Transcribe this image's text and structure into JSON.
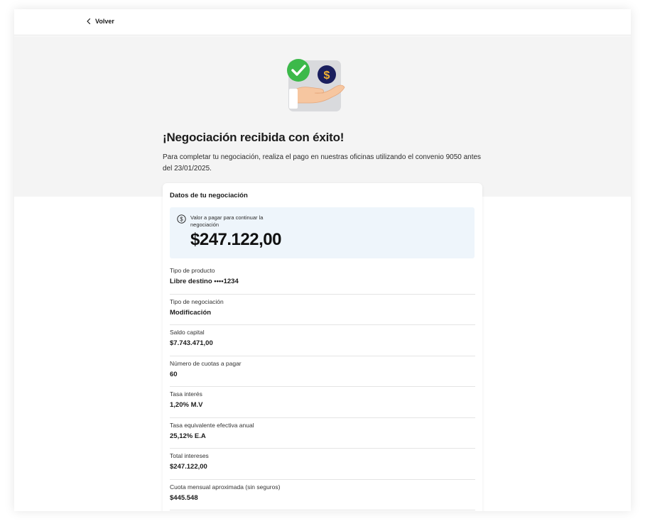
{
  "topbar": {
    "back_label": "Volver"
  },
  "hero": {
    "title": "¡Negociación recibida con éxito!",
    "subtitle": "Para completar tu negociación, realiza el pago en nuestras oficinas utilizando el convenio 9050 antes del 23/01/2025."
  },
  "card": {
    "title": "Datos de tu negociación",
    "payment": {
      "label": "Valor a pagar para continuar la negociación",
      "amount": "$247.122,00"
    },
    "rows": [
      {
        "label": "Tipo de producto",
        "value": "Libre destino ••••1234"
      },
      {
        "label": "Tipo de negociación",
        "value": "Modificación"
      },
      {
        "label": "Saldo capital",
        "value": "$7.743.471,00"
      },
      {
        "label": "Número de cuotas a pagar",
        "value": "60"
      },
      {
        "label": "Tasa interés",
        "value": "1,20% M.V"
      },
      {
        "label": "Tasa equivalente efectiva anual",
        "value": "25,12% E.A"
      },
      {
        "label": "Total intereses",
        "value": "$247.122,00"
      },
      {
        "label": "Cuota mensual aproximada (sin seguros)",
        "value": "$445.548"
      }
    ]
  },
  "colors": {
    "hero_bg": "#f4f4f4",
    "pay_box_bg": "#eef5fb",
    "check_green": "#3cb94a",
    "coin_navy": "#1a1f5e",
    "coin_symbol": "#f2b233"
  },
  "icons": [
    "chevron-left-icon",
    "check-circle-icon",
    "dollar-coin-icon",
    "hand-icon",
    "dollar-circle-icon"
  ]
}
